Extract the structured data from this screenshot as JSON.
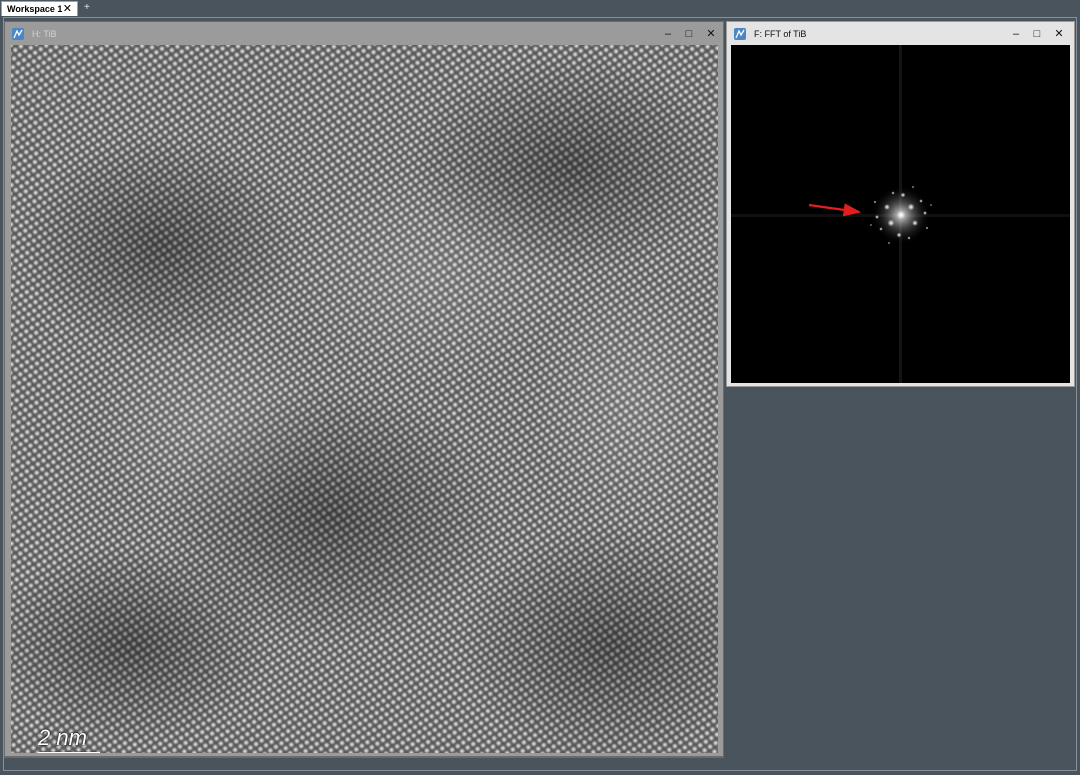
{
  "workspace_tab": {
    "label": "Workspace 1",
    "close_glyph": "✕",
    "add_glyph": "+"
  },
  "windows": {
    "hrtem": {
      "title": "H: TiB",
      "icon": "dm-image-icon",
      "minimize_glyph": "‒",
      "maximize_glyph": "□",
      "close_glyph": "✕",
      "scale_bar_label": "2 nm"
    },
    "fft": {
      "title": "F: FFT of TiB",
      "icon": "dm-image-icon",
      "minimize_glyph": "‒",
      "maximize_glyph": "□",
      "close_glyph": "✕",
      "arrow_color": "#e02020"
    }
  },
  "colors": {
    "desktop_bg": "#4a545d",
    "active_title_bg": "#e4e4e4",
    "inactive_title_bg": "#9b9b9b",
    "icon_bg": "#4a87c5"
  }
}
